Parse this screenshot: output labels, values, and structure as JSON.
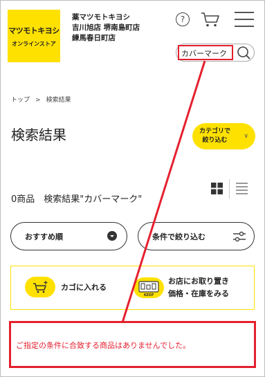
{
  "header": {
    "logo_line1": "マツモトキヨシ",
    "logo_line2": "オンラインストア",
    "store_lines": [
      "薬マツモトキヨシ",
      "吉川旭店 堺南島町店",
      "練馬春日町店"
    ],
    "help_label": "?"
  },
  "search": {
    "value": "カバーマーク"
  },
  "breadcrumb": {
    "top": "トップ",
    "sep": ">",
    "current": "検索結果"
  },
  "page_title": "検索結果",
  "category_button": {
    "label_line1": "カテゴリで",
    "label_line2": "絞り込む",
    "chevron": "∨"
  },
  "result_count": "0商品　検索結果\"カバーマーク\"",
  "sort_button": {
    "label": "おすすめ順"
  },
  "filter_button": {
    "label": "条件で絞り込む"
  },
  "legend": {
    "cart_label": "カゴに入れる",
    "keep_badge": "KEEP",
    "keep_line1": "お店にお取り置き",
    "keep_line2": "価格・在庫をみる"
  },
  "message": "ご指定の条件に合致する商品はありませんでした。",
  "colors": {
    "accent": "#ffe100",
    "alert": "#e5202e"
  }
}
